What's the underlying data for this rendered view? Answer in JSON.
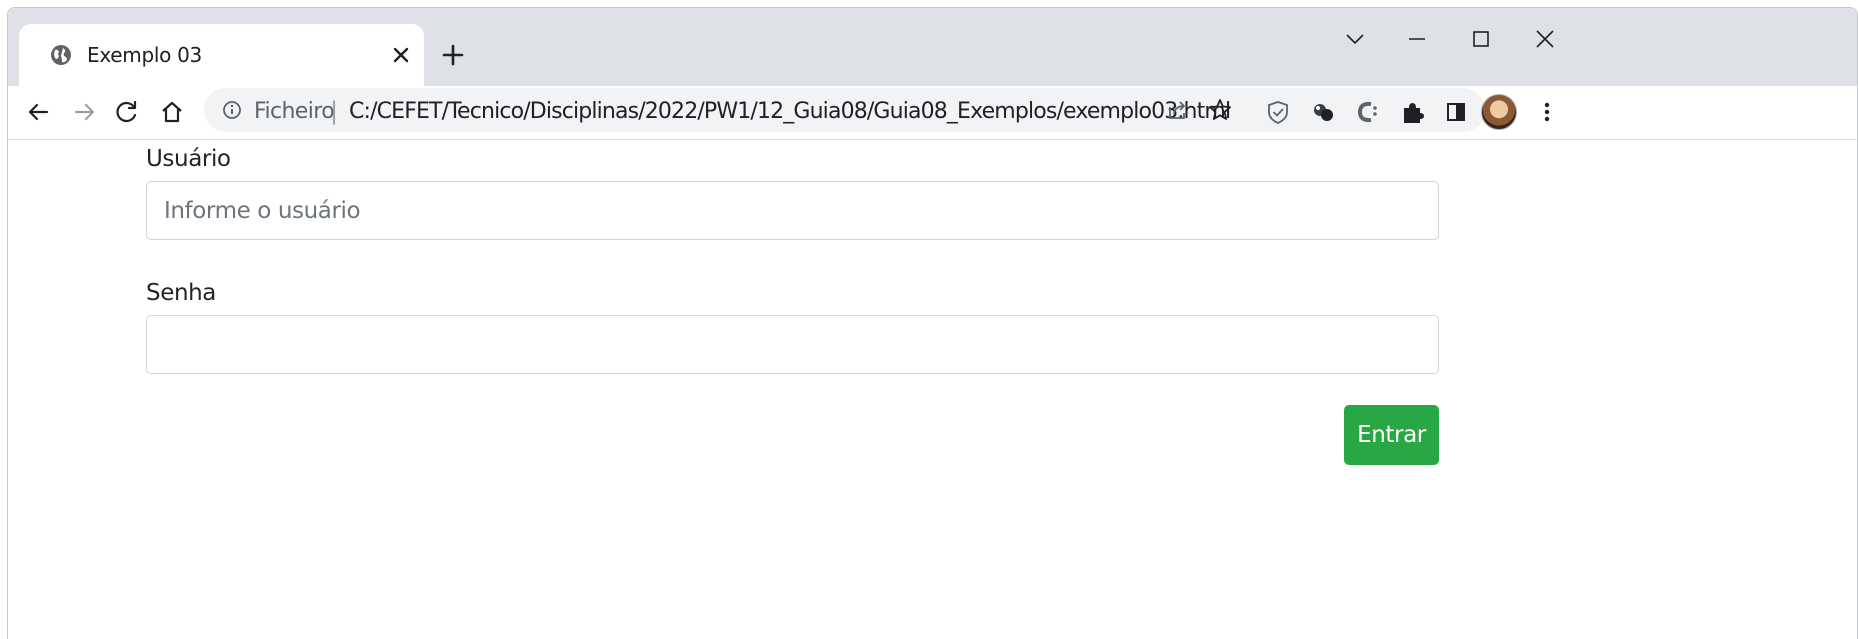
{
  "browser": {
    "tab": {
      "title": "Exemplo 03",
      "favicon": "globe-icon"
    },
    "omnibox": {
      "scheme_label": "Ficheiro",
      "separator": "|",
      "url": "C:/CEFET/Tecnico/Disciplinas/2022/PW1/12_Guia08/Guia08_Exemplos/exemplo03.html"
    },
    "toolbar_icons": [
      "back-arrow-icon",
      "forward-arrow-icon",
      "reload-icon",
      "home-icon",
      "info-icon",
      "share-icon",
      "star-icon",
      "shield-extension-icon",
      "extension-icon",
      "extension-c-icon",
      "puzzle-icon",
      "side-panel-icon",
      "avatar",
      "kebab-menu-icon"
    ],
    "window_controls": [
      "tab-search-icon",
      "minimize-icon",
      "maximize-icon",
      "close-window-icon"
    ]
  },
  "form": {
    "username": {
      "label": "Usuário",
      "placeholder": "Informe o usuário",
      "value": ""
    },
    "password": {
      "label": "Senha",
      "value": ""
    },
    "submit_label": "Entrar"
  },
  "colors": {
    "submit_button": "#28a745",
    "tabstrip": "#dee1e6",
    "omnibox": "#f1f3f4"
  }
}
